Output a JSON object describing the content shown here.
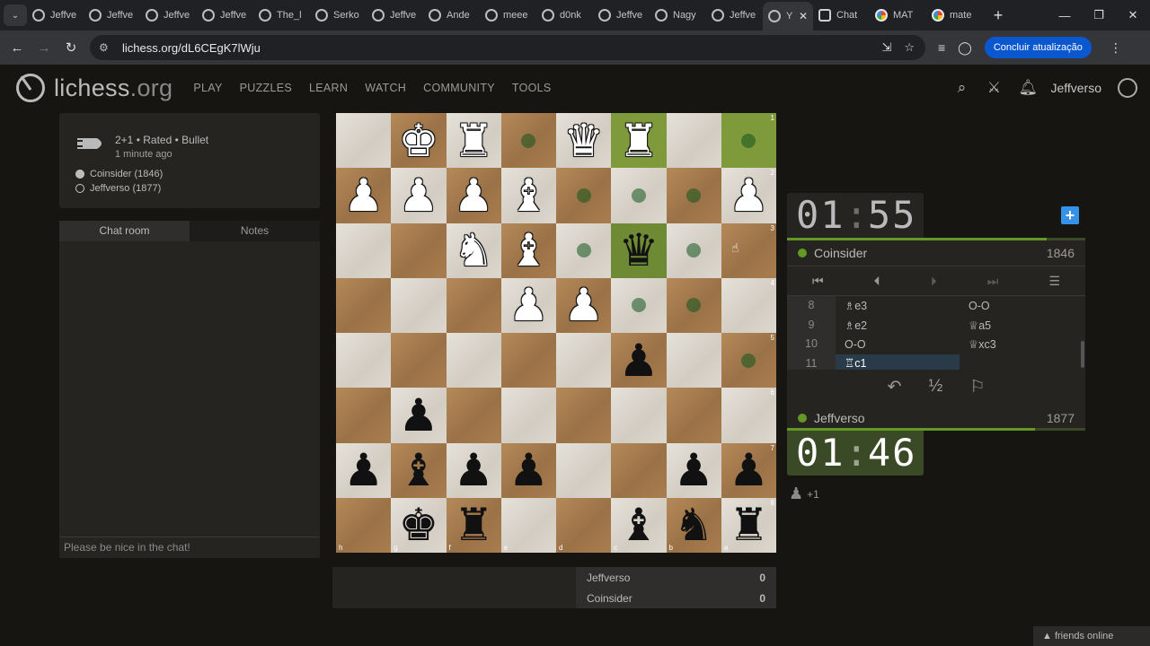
{
  "browser": {
    "tabs": [
      {
        "title": "Jeffve",
        "icon": "lichess"
      },
      {
        "title": "Jeffve",
        "icon": "lichess"
      },
      {
        "title": "Jeffve",
        "icon": "lichess"
      },
      {
        "title": "Jeffve",
        "icon": "lichess"
      },
      {
        "title": "The_l",
        "icon": "lichess"
      },
      {
        "title": "Serko",
        "icon": "lichess"
      },
      {
        "title": "Jeffve",
        "icon": "lichess"
      },
      {
        "title": "Ande",
        "icon": "lichess"
      },
      {
        "title": "meee",
        "icon": "lichess"
      },
      {
        "title": "d0nk",
        "icon": "lichess"
      },
      {
        "title": "Jeffve",
        "icon": "lichess"
      },
      {
        "title": "Nagy",
        "icon": "lichess"
      },
      {
        "title": "Jeffve",
        "icon": "lichess"
      }
    ],
    "active_tab": {
      "title": "Y"
    },
    "extra_tabs": [
      {
        "title": "Chat",
        "icon": "chatgpt"
      },
      {
        "title": "MAT",
        "icon": "google"
      },
      {
        "title": "mate",
        "icon": "google"
      }
    ],
    "url": "lichess.org/dL6CEgK7lWju",
    "update_button": "Concluir atualização"
  },
  "site": {
    "logo": "lichess",
    "logo_tld": ".org",
    "nav": [
      "PLAY",
      "PUZZLES",
      "LEARN",
      "WATCH",
      "COMMUNITY",
      "TOOLS"
    ],
    "username": "Jeffverso"
  },
  "game_info": {
    "meta": "2+1 • Rated • Bullet",
    "ago": "1 minute ago",
    "players": [
      {
        "name": "Coinsider (1846)",
        "color": "white"
      },
      {
        "name": "Jeffverso (1877)",
        "color": "black"
      }
    ]
  },
  "chat": {
    "tabs": [
      "Chat room",
      "Notes"
    ],
    "placeholder": "Please be nice in the chat!"
  },
  "board": {
    "orientation": "black",
    "ranks": [
      "1",
      "2",
      "3",
      "4",
      "5",
      "6",
      "7",
      "8"
    ],
    "files": [
      "h",
      "g",
      "f",
      "e",
      "d",
      "c",
      "b",
      "a"
    ],
    "rows": [
      [
        "",
        "wK",
        "wR",
        "",
        "wQ",
        "wR",
        "",
        ""
      ],
      [
        "wP",
        "wP",
        "wP",
        "wB",
        "",
        "",
        "",
        "wP"
      ],
      [
        "",
        "",
        "wN",
        "wB",
        "",
        "bQ",
        "",
        ""
      ],
      [
        "",
        "",
        "",
        "wP",
        "wP",
        "",
        "",
        ""
      ],
      [
        "",
        "",
        "",
        "",
        "",
        "bP",
        "",
        ""
      ],
      [
        "",
        "bP",
        "",
        "",
        "",
        "",
        "",
        ""
      ],
      [
        "bP",
        "bB",
        "bP",
        "bP",
        "",
        "",
        "bP",
        "bP"
      ],
      [
        "",
        "bK",
        "bR",
        "",
        "",
        "bB",
        "bN",
        "bR"
      ]
    ],
    "move_dots": [
      [
        0,
        3
      ],
      [
        0,
        7
      ],
      [
        1,
        4
      ],
      [
        1,
        5
      ],
      [
        1,
        6
      ],
      [
        2,
        4
      ],
      [
        2,
        6
      ],
      [
        3,
        5
      ],
      [
        3,
        6
      ],
      [
        4,
        7
      ]
    ],
    "last_move": [
      [
        0,
        5
      ],
      [
        0,
        7
      ]
    ],
    "selected": [
      [
        2,
        5
      ]
    ]
  },
  "clocks": {
    "top": {
      "min": "01",
      "sec": "55"
    },
    "bottom": {
      "min": "01",
      "sec": "46"
    },
    "top_fraction": 0.87,
    "bottom_fraction": 0.83
  },
  "players": {
    "top": {
      "name": "Coinsider",
      "rating": "1846"
    },
    "bottom": {
      "name": "Jeffverso",
      "rating": "1877"
    }
  },
  "moves": [
    {
      "n": "8",
      "w": "♗e3",
      "b": "O-O"
    },
    {
      "n": "9",
      "w": "♗e2",
      "b": "♕a5"
    },
    {
      "n": "10",
      "w": "O-O",
      "b": "♕xc3"
    },
    {
      "n": "11",
      "w": "♖c1",
      "b": ""
    }
  ],
  "material_diff": "+1",
  "crosstable": [
    {
      "name": "Jeffverso",
      "score": "0"
    },
    {
      "name": "Coinsider",
      "score": "0"
    }
  ],
  "friends": "▲ friends online",
  "colors": {
    "accent": "#629924",
    "link": "#3692e7",
    "bg": "#161512"
  }
}
